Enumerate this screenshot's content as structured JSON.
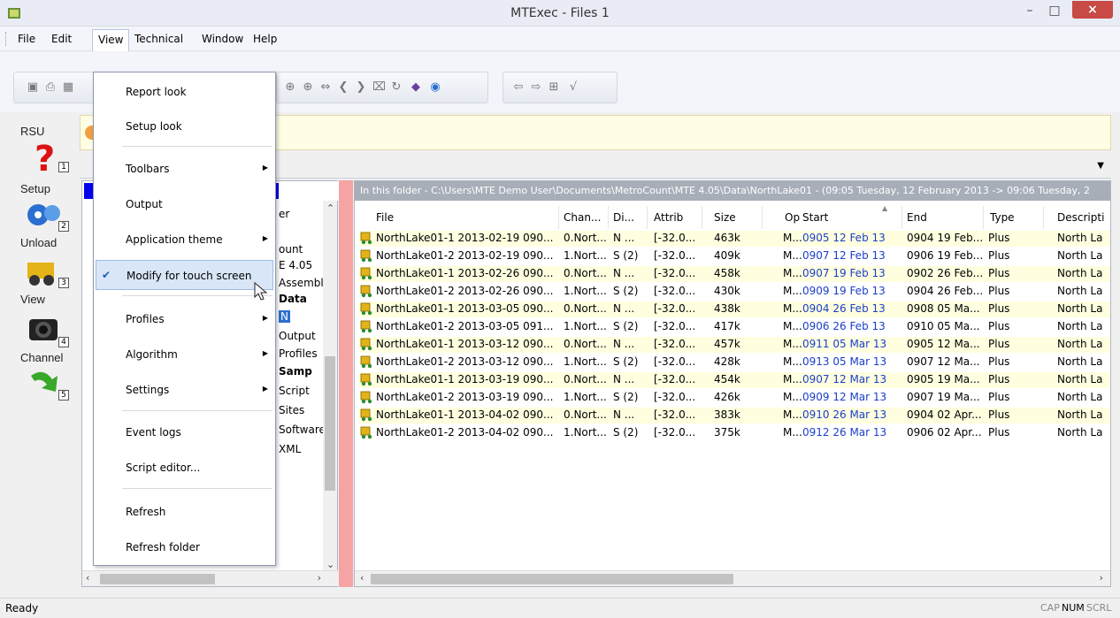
{
  "window": {
    "title": "MTExec - Files 1"
  },
  "menubar": {
    "items": [
      "File",
      "Edit",
      "View",
      "Technical",
      "Window",
      "Help"
    ]
  },
  "view_menu": {
    "items": [
      {
        "label": "Report look",
        "submenu": false
      },
      {
        "label": "Setup look",
        "submenu": false
      },
      {
        "label": "Toolbars",
        "submenu": true
      },
      {
        "label": "Output",
        "submenu": false
      },
      {
        "label": "Application theme",
        "submenu": true
      },
      {
        "label": "Modify for touch screen",
        "submenu": false,
        "checked": true
      },
      {
        "label": "Profiles",
        "submenu": true
      },
      {
        "label": "Algorithm",
        "submenu": true
      },
      {
        "label": "Settings",
        "submenu": true
      },
      {
        "label": "Event logs",
        "submenu": false
      },
      {
        "label": "Script editor...",
        "submenu": false
      },
      {
        "label": "Refresh",
        "submenu": false
      },
      {
        "label": "Refresh folder",
        "submenu": false
      }
    ]
  },
  "sidebar": {
    "items": [
      {
        "label": "RSU",
        "num": "1",
        "icon": "question-icon"
      },
      {
        "label": "Setup",
        "num": "2",
        "icon": "gears-icon"
      },
      {
        "label": "Unload",
        "num": "3",
        "icon": "truck-icon"
      },
      {
        "label": "View",
        "num": "4",
        "icon": "camera-icon"
      },
      {
        "label": "Channel",
        "num": "5",
        "icon": "green-arrow-icon"
      }
    ]
  },
  "tree": {
    "items": [
      "er",
      "ount",
      "E 4.05",
      "Assembl",
      "Data",
      "N",
      "Output",
      "Profiles",
      "Samp",
      "Script",
      "Sites",
      "Software",
      "XML"
    ]
  },
  "folder_bar": "In this folder - C:\\Users\\MTE Demo User\\Documents\\MetroCount\\MTE 4.05\\Data\\NorthLake01 - (09:05 Tuesday, 12 February 2013 -> 09:06 Tuesday, 2",
  "columns": [
    "File",
    "Chan...",
    "Di...",
    "Attrib",
    "Size",
    "Op",
    "Start",
    "End",
    "Type",
    "Descripti"
  ],
  "rows": [
    [
      "NorthLake01-1 2013-02-19 090...",
      "0.Nort...",
      "N ...",
      "[-32.0...",
      "463k",
      "M...",
      "0905 12 Feb 13",
      "0904 19 Feb...",
      "Plus",
      "North La"
    ],
    [
      "NorthLake01-2 2013-02-19 090...",
      "1.Nort...",
      "S (2)",
      "[-32.0...",
      "409k",
      "M...",
      "0907 12 Feb 13",
      "0906 19 Feb...",
      "Plus",
      "North La"
    ],
    [
      "NorthLake01-1 2013-02-26 090...",
      "0.Nort...",
      "N ...",
      "[-32.0...",
      "458k",
      "M...",
      "0907 19 Feb 13",
      "0902 26 Feb...",
      "Plus",
      "North La"
    ],
    [
      "NorthLake01-2 2013-02-26 090...",
      "1.Nort...",
      "S (2)",
      "[-32.0...",
      "430k",
      "M...",
      "0909 19 Feb 13",
      "0904 26 Feb...",
      "Plus",
      "North La"
    ],
    [
      "NorthLake01-1 2013-03-05 090...",
      "0.Nort...",
      "N ...",
      "[-32.0...",
      "438k",
      "M...",
      "0904 26 Feb 13",
      "0908 05 Ma...",
      "Plus",
      "North La"
    ],
    [
      "NorthLake01-2 2013-03-05 091...",
      "1.Nort...",
      "S (2)",
      "[-32.0...",
      "417k",
      "M...",
      "0906 26 Feb 13",
      "0910 05 Ma...",
      "Plus",
      "North La"
    ],
    [
      "NorthLake01-1 2013-03-12 090...",
      "0.Nort...",
      "N ...",
      "[-32.0...",
      "457k",
      "M...",
      "0911 05 Mar 13",
      "0905 12 Ma...",
      "Plus",
      "North La"
    ],
    [
      "NorthLake01-2 2013-03-12 090...",
      "1.Nort...",
      "S (2)",
      "[-32.0...",
      "428k",
      "M...",
      "0913 05 Mar 13",
      "0907 12 Ma...",
      "Plus",
      "North La"
    ],
    [
      "NorthLake01-1 2013-03-19 090...",
      "0.Nort...",
      "N ...",
      "[-32.0...",
      "454k",
      "M...",
      "0907 12 Mar 13",
      "0905 19 Ma...",
      "Plus",
      "North La"
    ],
    [
      "NorthLake01-2 2013-03-19 090...",
      "1.Nort...",
      "S (2)",
      "[-32.0...",
      "426k",
      "M...",
      "0909 12 Mar 13",
      "0907 19 Ma...",
      "Plus",
      "North La"
    ],
    [
      "NorthLake01-1 2013-04-02 090...",
      "0.Nort...",
      "N ...",
      "[-32.0...",
      "383k",
      "M...",
      "0910 26 Mar 13",
      "0904 02 Apr...",
      "Plus",
      "North La"
    ],
    [
      "NorthLake01-2 2013-04-02 090...",
      "1.Nort...",
      "S (2)",
      "[-32.0...",
      "375k",
      "M...",
      "0912 26 Mar 13",
      "0906 02 Apr...",
      "Plus",
      "North La"
    ]
  ],
  "status": {
    "text": "Ready",
    "indicators": [
      {
        "label": "CAP",
        "on": false
      },
      {
        "label": "NUM",
        "on": true
      },
      {
        "label": "SCRL",
        "on": false
      }
    ]
  },
  "colors": {
    "close": "#c74a45",
    "splitter": "#f6a3a3",
    "row_alt": "#ffffe0",
    "highlight": "#cde3f7",
    "link": "#1a3fc7"
  }
}
